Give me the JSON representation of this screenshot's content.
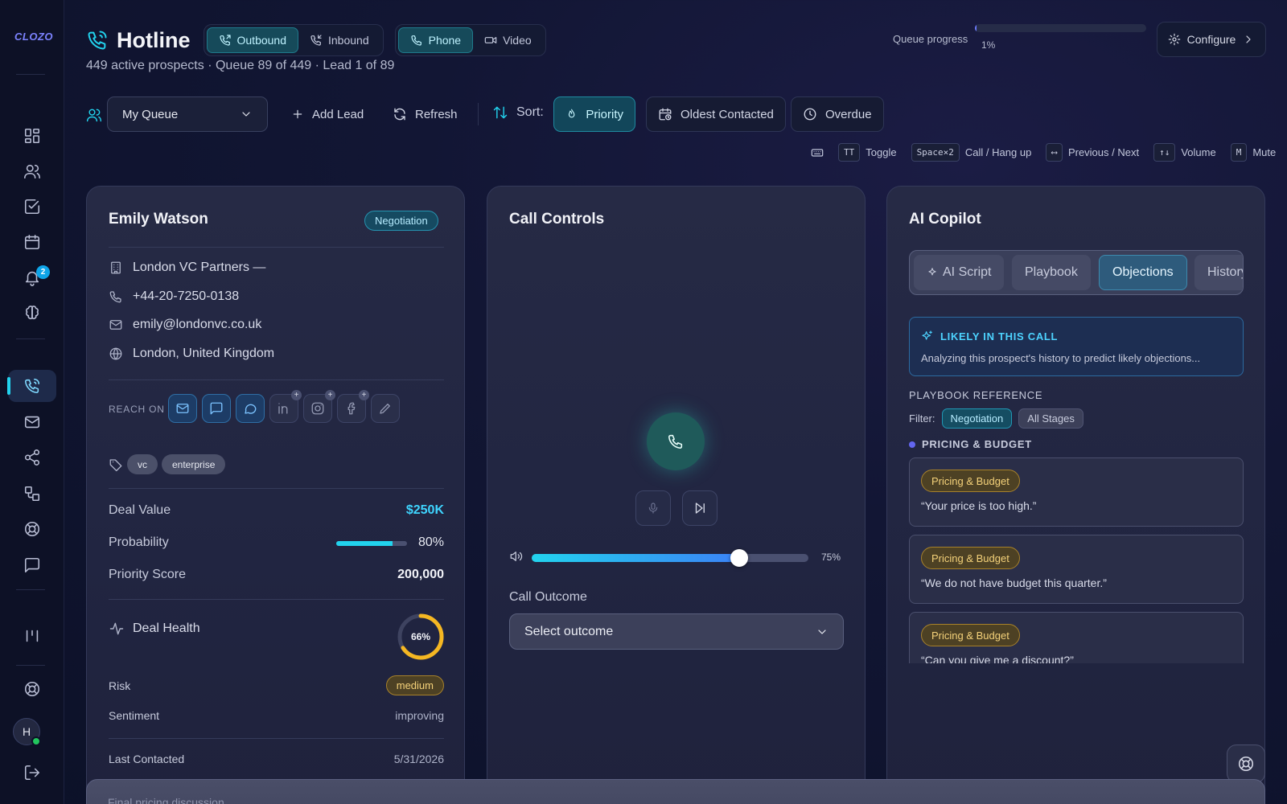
{
  "app": {
    "logo_text": "CLOZO",
    "title": "Hotline"
  },
  "mode_tabs": [
    {
      "label": "Outbound",
      "active": true
    },
    {
      "label": "Inbound",
      "active": false
    }
  ],
  "channel_tabs": [
    {
      "label": "Phone",
      "active": true
    },
    {
      "label": "Video",
      "active": false
    }
  ],
  "subtitle": "449 active prospects · Queue 89 of 449 · Lead 1 of 89",
  "queue_progress": {
    "label": "Queue progress",
    "value_text": "1%",
    "value": 0.01
  },
  "configure_label": "Configure",
  "sidebar": {
    "notification_count": "2",
    "avatar_initial": "H",
    "active_item": "phone"
  },
  "toolbar": {
    "queue_value": "My Queue",
    "add_lead": "Add Lead",
    "refresh": "Refresh",
    "sort_label": "Sort:",
    "sort_options": [
      {
        "label": "Priority",
        "active": true
      },
      {
        "label": "Oldest Contacted",
        "active": false
      },
      {
        "label": "Overdue",
        "active": false
      }
    ]
  },
  "shortcuts": [
    {
      "key": "TT",
      "label": "Toggle"
    },
    {
      "key": "Space×2",
      "label": "Call / Hang up"
    },
    {
      "key": "⟷",
      "label": "Previous / Next"
    },
    {
      "key": "↑↓",
      "label": "Volume"
    },
    {
      "key": "M",
      "label": "Mute"
    }
  ],
  "lead": {
    "name": "Emily Watson",
    "stage": "Negotiation",
    "company": "London VC Partners —",
    "phone": "+44-20-7250-0138",
    "email": "emily@londonvc.co.uk",
    "location": "London, United Kingdom",
    "reach_label": "REACH ON",
    "tags": [
      "vc",
      "enterprise"
    ],
    "deal_value_label": "Deal Value",
    "deal_value": "$250K",
    "probability_label": "Probability",
    "probability_text": "80%",
    "probability": 0.8,
    "priority_label": "Priority Score",
    "priority_score": "200,000",
    "health_label": "Deal Health",
    "health_text": "66%",
    "health": 0.66,
    "risk_label": "Risk",
    "risk": "medium",
    "sentiment_label": "Sentiment",
    "sentiment": "improving",
    "last_contacted_label": "Last Contacted",
    "last_contacted": "5/31/2026"
  },
  "call": {
    "title": "Call Controls",
    "volume_text": "75%",
    "volume": 0.75,
    "outcome_label": "Call Outcome",
    "outcome_placeholder": "Select outcome"
  },
  "ai": {
    "title": "AI Copilot",
    "tabs": [
      {
        "label": "AI Script",
        "active": false
      },
      {
        "label": "Playbook",
        "active": false
      },
      {
        "label": "Objections",
        "active": true
      },
      {
        "label": "History",
        "active": false
      }
    ],
    "likely_title": "LIKELY IN THIS CALL",
    "likely_text": "Analyzing this prospect's history to predict likely objections...",
    "playbook_ref": "PLAYBOOK REFERENCE",
    "filter_label": "Filter:",
    "filters": [
      {
        "label": "Negotiation",
        "active": true
      },
      {
        "label": "All Stages",
        "active": false
      }
    ],
    "category": "PRICING & BUDGET",
    "objections": [
      {
        "badge": "Pricing & Budget",
        "text": "“Your price is too high.”"
      },
      {
        "badge": "Pricing & Budget",
        "text": "“We do not have budget this quarter.”"
      },
      {
        "badge": "Pricing & Budget",
        "text": "“Can you give me a discount?”"
      }
    ]
  },
  "bottom_sheet_text": "Final pricing discussion",
  "colors": {
    "accent": "#22d3ee",
    "background": "#121634",
    "card": "#242844",
    "warning": "#f5d27a",
    "online": "#22c55e"
  }
}
